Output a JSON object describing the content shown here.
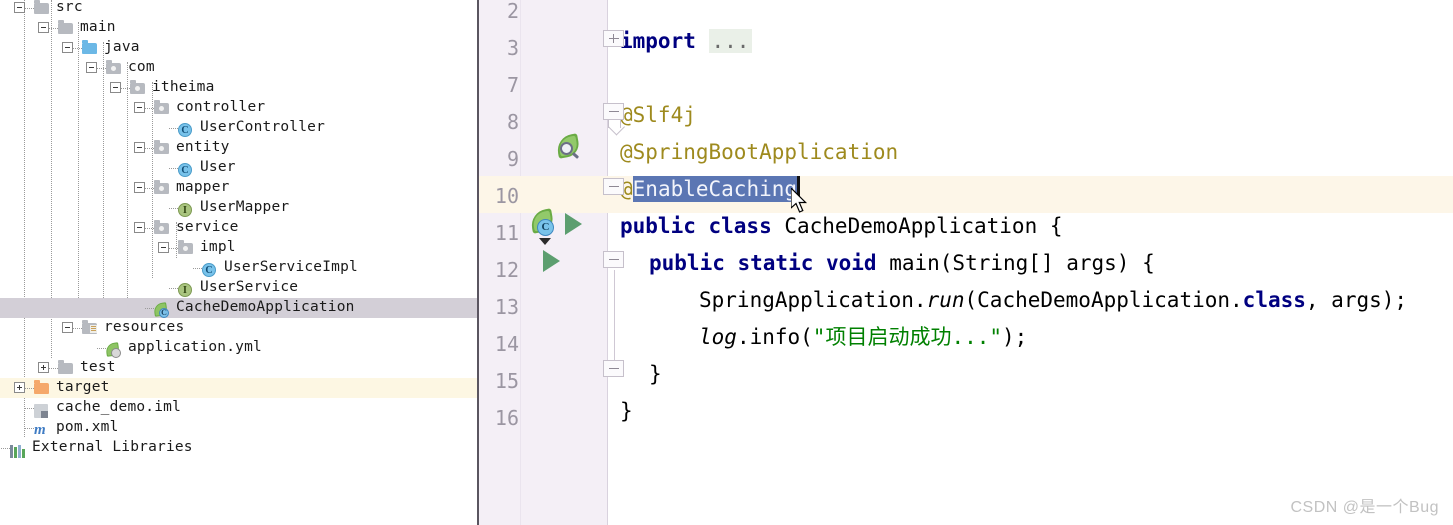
{
  "app": {
    "watermark": "CSDN @是一个Bug"
  },
  "project_tree": {
    "name": "project-tool-window",
    "rows": [
      {
        "label": "src",
        "depth": 1,
        "icon": "folder-gray",
        "expander": "minus",
        "state": "normal"
      },
      {
        "label": "main",
        "depth": 2,
        "icon": "folder-gray",
        "expander": "minus",
        "state": "normal"
      },
      {
        "label": "java",
        "depth": 3,
        "icon": "folder-blue",
        "expander": "minus",
        "state": "normal"
      },
      {
        "label": "com",
        "depth": 4,
        "icon": "folder-package",
        "expander": "minus",
        "state": "normal"
      },
      {
        "label": "itheima",
        "depth": 5,
        "icon": "folder-package",
        "expander": "minus",
        "state": "normal"
      },
      {
        "label": "controller",
        "depth": 6,
        "icon": "folder-package",
        "expander": "minus",
        "state": "normal"
      },
      {
        "label": "UserController",
        "depth": 7,
        "icon": "class-badge",
        "expander": "none",
        "state": "normal"
      },
      {
        "label": "entity",
        "depth": 6,
        "icon": "folder-package",
        "expander": "minus",
        "state": "normal"
      },
      {
        "label": "User",
        "depth": 7,
        "icon": "class-badge",
        "expander": "none",
        "state": "normal"
      },
      {
        "label": "mapper",
        "depth": 6,
        "icon": "folder-package",
        "expander": "minus",
        "state": "normal"
      },
      {
        "label": "UserMapper",
        "depth": 7,
        "icon": "interface-badge",
        "expander": "none",
        "state": "normal"
      },
      {
        "label": "service",
        "depth": 6,
        "icon": "folder-package",
        "expander": "minus",
        "state": "normal"
      },
      {
        "label": "impl",
        "depth": 7,
        "icon": "folder-package",
        "expander": "minus",
        "state": "normal"
      },
      {
        "label": "UserServiceImpl",
        "depth": 8,
        "icon": "class-badge",
        "expander": "none",
        "state": "normal"
      },
      {
        "label": "UserService",
        "depth": 7,
        "icon": "interface-badge",
        "expander": "none",
        "state": "normal"
      },
      {
        "label": "CacheDemoApplication",
        "depth": 6,
        "icon": "spring-class",
        "expander": "none",
        "state": "selected"
      },
      {
        "label": "resources",
        "depth": 3,
        "icon": "folder-resources",
        "expander": "minus",
        "state": "normal"
      },
      {
        "label": "application.yml",
        "depth": 4,
        "icon": "spring-yaml",
        "expander": "none",
        "state": "normal"
      },
      {
        "label": "test",
        "depth": 2,
        "icon": "folder-gray",
        "expander": "plus",
        "state": "normal"
      },
      {
        "label": "target",
        "depth": 1,
        "icon": "folder-orange",
        "expander": "plus",
        "state": "excluded"
      },
      {
        "label": "cache_demo.iml",
        "depth": 1,
        "icon": "iml-file",
        "expander": "none",
        "state": "normal"
      },
      {
        "label": "pom.xml",
        "depth": 1,
        "icon": "maven-file",
        "expander": "none",
        "state": "normal"
      },
      {
        "label": "External Libraries",
        "depth": 0,
        "icon": "libraries",
        "expander": "none",
        "state": "normal"
      }
    ]
  },
  "editor": {
    "name": "code-editor",
    "lines": [
      {
        "number": "2",
        "gutter_icon": "none",
        "fold": "none",
        "current": false
      },
      {
        "number": "3",
        "gutter_icon": "none",
        "fold": "plus",
        "current": false
      },
      {
        "number": "7",
        "gutter_icon": "none",
        "fold": "none",
        "current": false
      },
      {
        "number": "8",
        "gutter_icon": "none",
        "fold": "minus-top",
        "current": false
      },
      {
        "number": "9",
        "gutter_icon": "spring-search",
        "fold": "none",
        "current": false
      },
      {
        "number": "10",
        "gutter_icon": "none",
        "fold": "minus-top",
        "current": true
      },
      {
        "number": "11",
        "gutter_icon": "spring-run-class",
        "fold": "none",
        "current": false
      },
      {
        "number": "12",
        "gutter_icon": "run",
        "fold": "minus-top",
        "current": false
      },
      {
        "number": "13",
        "gutter_icon": "none",
        "fold": "none",
        "current": false
      },
      {
        "number": "14",
        "gutter_icon": "none",
        "fold": "none",
        "current": false
      },
      {
        "number": "15",
        "gutter_icon": "none",
        "fold": "minus-bottom",
        "current": false
      },
      {
        "number": "16",
        "gutter_icon": "none",
        "fold": "none",
        "current": false
      }
    ],
    "code": {
      "line3_import": "import",
      "line3_folded": "...",
      "line8": "@Slf4j",
      "line9": "@SpringBootApplication",
      "line10_at": "@",
      "line10_selected": "EnableCaching",
      "line11_kw": "public class",
      "line11_name": " CacheDemoApplication {",
      "line12_kw1": "public static void",
      "line12_rest": " main(String[] args) {",
      "line13_a": "SpringApplication.",
      "line13_run": "run",
      "line13_b": "(CacheDemoApplication.",
      "line13_class": "class",
      "line13_c": ", args);",
      "line14_log": "log",
      "line14_a": ".info(",
      "line14_str": "\"项目启动成功...\"",
      "line14_b": ");",
      "line15": "}",
      "line16": "}"
    },
    "colors": {
      "selection": "#5b76b3",
      "current_line": "#fdf6e8",
      "annotation": "#9e8a1e",
      "keyword": "#000080",
      "string": "#008000",
      "gutter_bg": "#f4eff6"
    }
  }
}
